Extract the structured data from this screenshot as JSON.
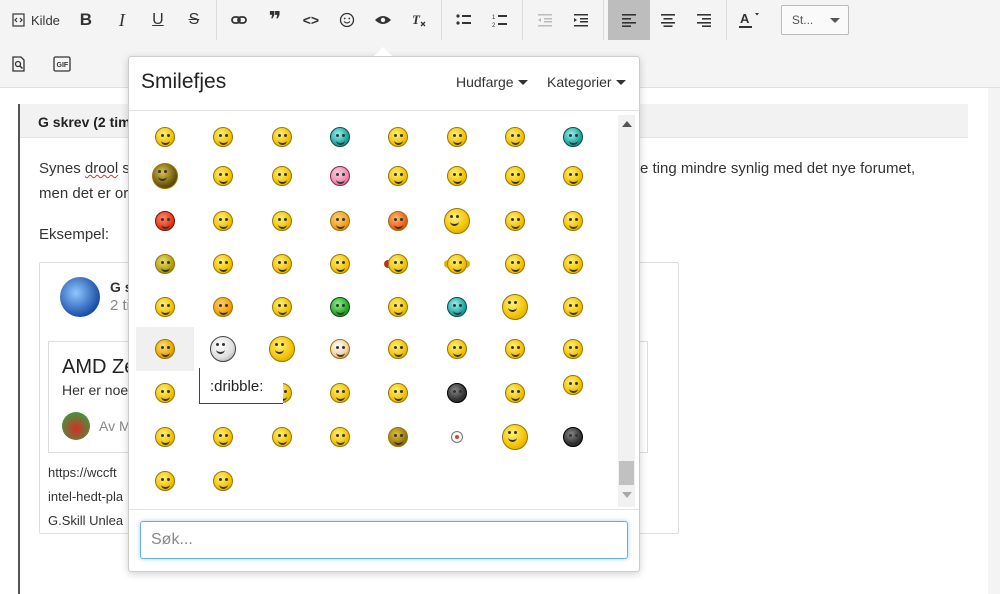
{
  "toolbar": {
    "source_label": "Kilde",
    "bold": "B",
    "italic": "I",
    "underline": "U",
    "strike": "S",
    "quote": "❞",
    "code": "<>",
    "styles_label": "St..."
  },
  "popup": {
    "title": "Smilefjes",
    "skin_tone_label": "Hudfarge",
    "categories_label": "Kategorier",
    "search_placeholder": "Søk...",
    "tooltip": ":dribble:"
  },
  "post": {
    "quote_header": "G skrev (2 tim",
    "line1_prefix": "Synes ",
    "line1_word": "drool",
    "line1_after": " s",
    "line1_right": "e ting mindre synlig med det nye forumet,",
    "line2": "men det er or",
    "example_label": "Eksempel:",
    "embed_name": "G s",
    "embed_time": "2 ti",
    "card_title": "AMD Ze",
    "card_desc": "Her er noe",
    "card_author": "Av M",
    "link1": "https://wccft",
    "link2": "intel-hedt-pla",
    "link3": "G.Skill Unlea"
  }
}
